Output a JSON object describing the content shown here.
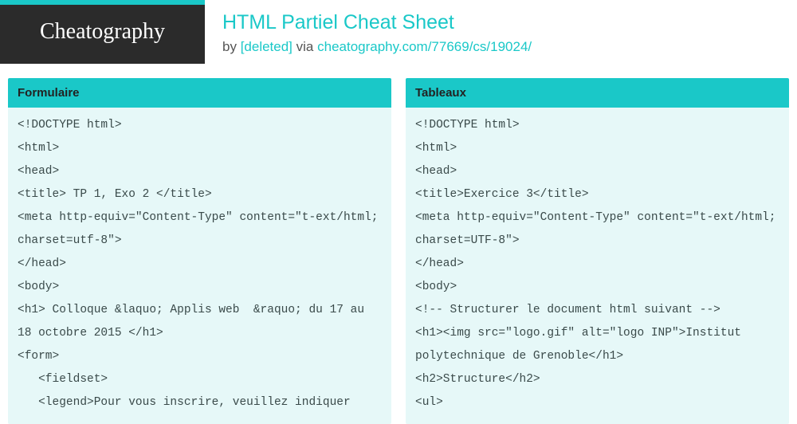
{
  "logo": "Cheatography",
  "title": "HTML Partiel Cheat Sheet",
  "byline_prefix": "by ",
  "byline_author": "[deleted]",
  "byline_via": " via ",
  "byline_link": "cheatography.com/77669/cs/19024/",
  "left": {
    "header": "Formulaire",
    "code": "<!DOCTYPE html>\n<html>\n<head>\n<title> TP 1, Exo 2 </title>\n<meta http-equiv=\"Content-Type\" content=\"t‐ext/html; charset=utf-8\">\n</head>\n<body>\n<h1> Colloque &laquo; Applis web  &raquo; du 17 au 18 octobre 2015 </h1>\n<form>\n   <fieldset>\n   <legend>Pour vous inscrire, veuillez indiquer"
  },
  "right": {
    "header": "Tableaux",
    "code": "<!DOCTYPE html>\n<html>\n<head>\n<title>Exercice 3</title>\n<meta http-equiv=\"Content-Type\" content=\"t‐ext/html; charset=UTF-8\">\n</head>\n<body>\n<!-- Structurer le document html suivant -->\n<h1><img src=\"logo.gif\" alt=\"logo INP\">Institut polytechnique de Grenoble</h1>\n<h2>Structure</h2>\n<ul>"
  }
}
